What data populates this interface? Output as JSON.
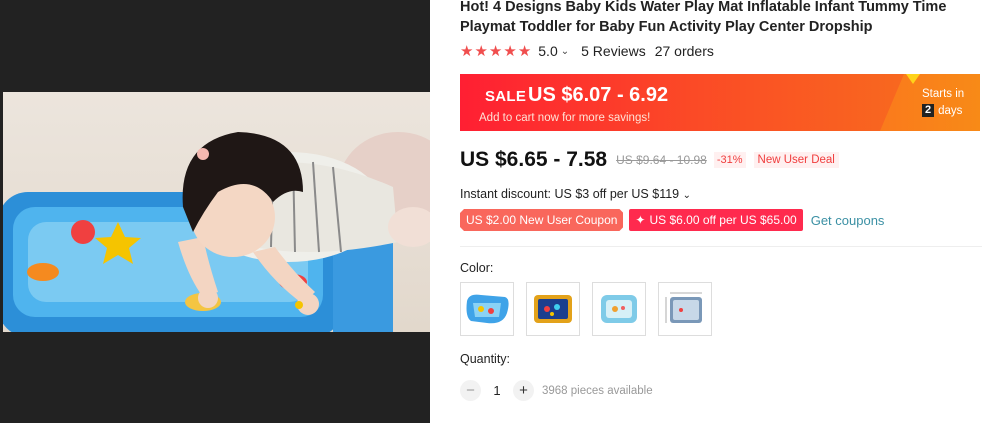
{
  "product": {
    "title": "Hot! 4 Designs Baby Kids Water Play Mat Inflatable Infant Tummy Time Playmat Toddler for Baby Fun Activity Play Center Dropship",
    "rating": "5.0",
    "stars": 5,
    "reviews_label": "5 Reviews",
    "orders_label": "27 orders"
  },
  "sale": {
    "label": "SALE",
    "price": "US $6.07 - 6.92",
    "subtitle": "Add to cart now for more savings!",
    "starts_in_label": "Starts in",
    "days_count": "2",
    "days_label": "days"
  },
  "pricing": {
    "price": "US $6.65 - 7.58",
    "original_price": "US $9.64 - 10.98",
    "discount": "-31%",
    "new_user_deal": "New User Deal"
  },
  "coupons": {
    "instant_discount": "Instant discount: US $3 off per US $119",
    "coupon1": "US $2.00 New User Coupon",
    "coupon2_icon": "✦",
    "coupon2": "US $6.00 off per US $65.00",
    "get_coupons": "Get coupons"
  },
  "color": {
    "label": "Color:",
    "options": [
      "water-mat-design-1",
      "water-mat-design-2",
      "water-mat-design-3",
      "water-mat-design-4"
    ]
  },
  "quantity": {
    "label": "Quantity:",
    "minus": "−",
    "value": "1",
    "plus": "+",
    "available": "3968 pieces available"
  },
  "colors": {
    "accent_red": "#f04e4e",
    "sale_gradient_start": "#ff1f33",
    "sale_gradient_end": "#f7731c",
    "link": "#3b90a4"
  }
}
